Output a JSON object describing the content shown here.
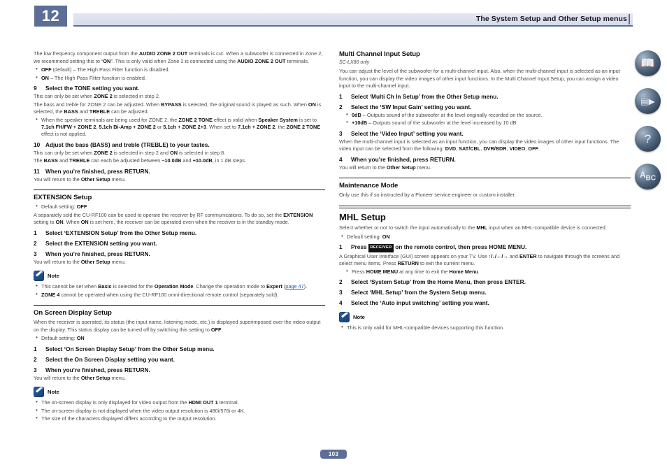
{
  "header": {
    "chapter": "12",
    "title": "The System Setup and Other Setup menus"
  },
  "page_number": "103",
  "side_icons": [
    {
      "name": "manual-book-icon",
      "glyph": "📖"
    },
    {
      "name": "remote-control-icon",
      "glyph": "▤"
    },
    {
      "name": "faq-question-icon",
      "glyph": "?"
    },
    {
      "name": "glossary-abc-icon",
      "glyph": "A"
    }
  ],
  "left_column": {
    "intro_p1_a": "The low frequency component output from the ",
    "intro_p1_b": "AUDIO ZONE 2 OUT",
    "intro_p1_c": " terminals is cut. When a subwoofer is connected in Zone 2, we recommend setting this to “",
    "intro_p1_d": "ON",
    "intro_p1_e": "”. This is only valid when Zone 2 is connected using the ",
    "intro_p1_f": "AUDIO ZONE 2 OUT",
    "intro_p1_g": " terminals.",
    "bullet_off_label": "OFF",
    "bullet_off_text": " (default) – The High Pass Filter function is disabled.",
    "bullet_on_label": "ON",
    "bullet_on_text": " – The High Pass Filter function is enabled.",
    "step9_num": "9",
    "step9_text": "Select the TONE setting you want.",
    "step9_p1_a": "This can only be set when ",
    "step9_p1_b": "ZONE 2",
    "step9_p1_c": " is selected in step 2.",
    "step9_p2_a": "The bass and treble for ZONE 2 can be adjusted. When ",
    "step9_p2_b": "BYPASS",
    "step9_p2_c": " is selected, the original sound is played as such. When ",
    "step9_p2_d": "ON",
    "step9_p2_e": " is selected, the ",
    "step9_p2_f": "BASS",
    "step9_p2_g": " and ",
    "step9_p2_h": "TREBLE",
    "step9_p2_i": " can be adjusted.",
    "step9_bullet_a": "When the speaker terminals are being used for ZONE 2, the ",
    "step9_bullet_b": "ZONE 2 TONE",
    "step9_bullet_c": " effect is valid when ",
    "step9_bullet_d": "Speaker System",
    "step9_bullet_e": " is set to ",
    "step9_bullet_f": "7.1ch FH/FW + ZONE 2",
    "step9_bullet_g": ", ",
    "step9_bullet_h": "5.1ch Bi-Amp + ZONE 2",
    "step9_bullet_i": " or ",
    "step9_bullet_j": "5.1ch + ZONE 2+3",
    "step9_bullet_k": ". When set to ",
    "step9_bullet_l": "7.1ch + ZONE 2",
    "step9_bullet_m": ", the ",
    "step9_bullet_n": "ZONE 2 TONE",
    "step9_bullet_o": " effect is not applied.",
    "step10_num": "10",
    "step10_text": "Adjust the bass (BASS) and treble (TREBLE) to your tastes.",
    "step10_p1_a": "This can only be set when ",
    "step10_p1_b": "ZONE 2",
    "step10_p1_c": " is selected in step 2 and ",
    "step10_p1_d": "ON",
    "step10_p1_e": " is selected in step 8.",
    "step10_p2_a": "The ",
    "step10_p2_b": "BASS",
    "step10_p2_c": " and ",
    "step10_p2_d": "TREBLE",
    "step10_p2_e": " can each be adjusted between ",
    "step10_p2_f": "–10.0dB",
    "step10_p2_g": " and ",
    "step10_p2_h": "+10.0dB",
    "step10_p2_i": ", in 1 dB steps.",
    "step11_num": "11",
    "step11_text": "When you’re finished, press RETURN.",
    "step11_p1_a": "You will return to the ",
    "step11_p1_b": "Other Setup",
    "step11_p1_c": " menu.",
    "extension_heading": "EXTENSION Setup",
    "extension_default_a": "Default setting: ",
    "extension_default_b": "OFF",
    "extension_p_a": "A separately sold the CU-RF100 can be used to operate the receiver by RF communications. To do so, set the ",
    "extension_p_b": "EXTENSION",
    "extension_p_c": " setting to ",
    "extension_p_d": "ON",
    "extension_p_e": ". When ",
    "extension_p_f": "ON",
    "extension_p_g": " is set here, the receiver can be operated even when the receiver is in the standby mode.",
    "ext_step1_num": "1",
    "ext_step1_text": "Select ‘EXTENSION Setup’ from the Other Setup menu.",
    "ext_step2_num": "2",
    "ext_step2_text": "Select the EXTENSION setting you want.",
    "ext_step3_num": "3",
    "ext_step3_text": "When you’re finished, press RETURN.",
    "ext_step3_p_a": "You will return to the ",
    "ext_step3_p_b": "Other Setup",
    "ext_step3_p_c": " menu.",
    "note1_label": "Note",
    "note1_b1_a": "This cannot be set when ",
    "note1_b1_b": "Basic",
    "note1_b1_c": " is selected for the ",
    "note1_b1_d": "Operation Mode",
    "note1_b1_e": ". Change the operation mode to ",
    "note1_b1_f": "Expert",
    "note1_b1_link": "page 47",
    "note1_b1_g": ").",
    "note1_b2_a": "ZONE 4",
    "note1_b2_b": " cannot be operated when using the CU-RF100 omni-directional remote control (separately sold).",
    "osd_heading": "On Screen Display Setup",
    "osd_p_a": "When the receiver is operated, its status (the input name, listening mode, etc.) is displayed superimposed over the video output on the display. This status display can be turned off by switching this setting to ",
    "osd_p_b": "OFF",
    "osd_p_c": ".",
    "osd_default_a": "Default setting: ",
    "osd_default_b": "ON",
    "osd_step1_num": "1",
    "osd_step1_text": "Select ‘On Screen Display Setup’ from the Other Setup menu.",
    "osd_step2_num": "2",
    "osd_step2_text": "Select the On Screen Display setting you want.",
    "osd_step3_num": "3",
    "osd_step3_text": "When you’re finished, press RETURN.",
    "osd_step3_p_a": "You will return to the ",
    "osd_step3_p_b": "Other Setup",
    "osd_step3_p_c": " menu.",
    "note2_label": "Note",
    "note2_b1_a": "The on-screen display is only displayed for video output from the ",
    "note2_b1_b": "HDMI OUT 1",
    "note2_b1_c": " terminal.",
    "note2_b2": "The on-screen display is not displayed when the video output resolution is 480i/576i or 4K.",
    "note2_b3": "The size of the characters displayed differs according to the output resolution."
  },
  "right_column": {
    "mci_heading": "Multi Channel Input Setup",
    "mci_model": "SC-LX86 only",
    "mci_p": "You can adjust the level of the subwoofer for a multi-channel input. Also, when the multi-channel input is selected as an input function, you can display the video images of other input functions. In the Multi Channel Input Setup, you can assign a video input to the multi-channel input.",
    "mci_step1_num": "1",
    "mci_step1_text": "Select ‘Multi Ch In Setup’ from the Other Setup menu.",
    "mci_step2_num": "2",
    "mci_step2_text": "Select the ‘SW Input Gain’ setting you want.",
    "mci_b1_a": "0dB",
    "mci_b1_b": " – Outputs sound of the subwoofer at the level originally recorded on the source.",
    "mci_b2_a": "+10dB",
    "mci_b2_b": " – Outputs sound of the subwoofer at the level increased by 10 dB.",
    "mci_step3_num": "3",
    "mci_step3_text": "Select the ‘Video Input’ setting you want.",
    "mci_step3_p_a": "When the multi-channel input is selected as an input function, you can display the video images of other input functions. The video input can be selected from the following: ",
    "mci_step3_p_b": "DVD",
    "mci_step3_p_c": ", ",
    "mci_step3_p_d": "SAT/CBL",
    "mci_step3_p_e": ", ",
    "mci_step3_p_f": "DVR/BDR",
    "mci_step3_p_g": ", ",
    "mci_step3_p_h": "VIDEO",
    "mci_step3_p_i": ", ",
    "mci_step3_p_j": "OFF",
    "mci_step3_p_k": ".",
    "mci_step4_num": "4",
    "mci_step4_text": "When you’re finished, press RETURN.",
    "mci_step4_p_a": "You will return to the ",
    "mci_step4_p_b": "Other Setup",
    "mci_step4_p_c": " menu.",
    "maint_heading": "Maintenance Mode",
    "maint_p": "Only use this if so instructed by a Pioneer service engineer or custom installer.",
    "mhl_heading": "MHL Setup",
    "mhl_p_a": "Select whether or not to switch the input automatically to the ",
    "mhl_p_b": "MHL",
    "mhl_p_c": " input when an MHL-compatible device is connected.",
    "mhl_default_a": "Default setting: ",
    "mhl_default_b": "ON",
    "mhl_step1_num": "1",
    "mhl_step1_text_a": "Press ",
    "mhl_step1_kbd": "RECEIVER",
    "mhl_step1_text_b": " on the remote control, then press HOME MENU.",
    "mhl_step1_p_a": "A Graphical User Interface (GUI) screen appears on your TV. Use ",
    "mhl_step1_p_arrows": "↑/↓/←/→",
    "mhl_step1_p_b": " and ",
    "mhl_step1_p_c": "ENTER",
    "mhl_step1_p_d": " to navigate through the screens and select menu items. Press ",
    "mhl_step1_p_e": "RETURN",
    "mhl_step1_p_f": " to exit the current menu.",
    "mhl_step1_bullet_a": "Press ",
    "mhl_step1_bullet_b": "HOME MENU",
    "mhl_step1_bullet_c": " at any time to exit the ",
    "mhl_step1_bullet_d": "Home Menu",
    "mhl_step1_bullet_e": ".",
    "mhl_step2_num": "2",
    "mhl_step2_text": "Select ‘System Setup’ from the Home Menu, then press ENTER.",
    "mhl_step3_num": "3",
    "mhl_step3_text": "Select ‘MHL Setup’ from the System Setup menu.",
    "mhl_step4_num": "4",
    "mhl_step4_text": "Select the ‘Auto input switching’ setting you want.",
    "note3_label": "Note",
    "note3_b1": "This is only valid for MHL-compatible devices supporting this function."
  }
}
